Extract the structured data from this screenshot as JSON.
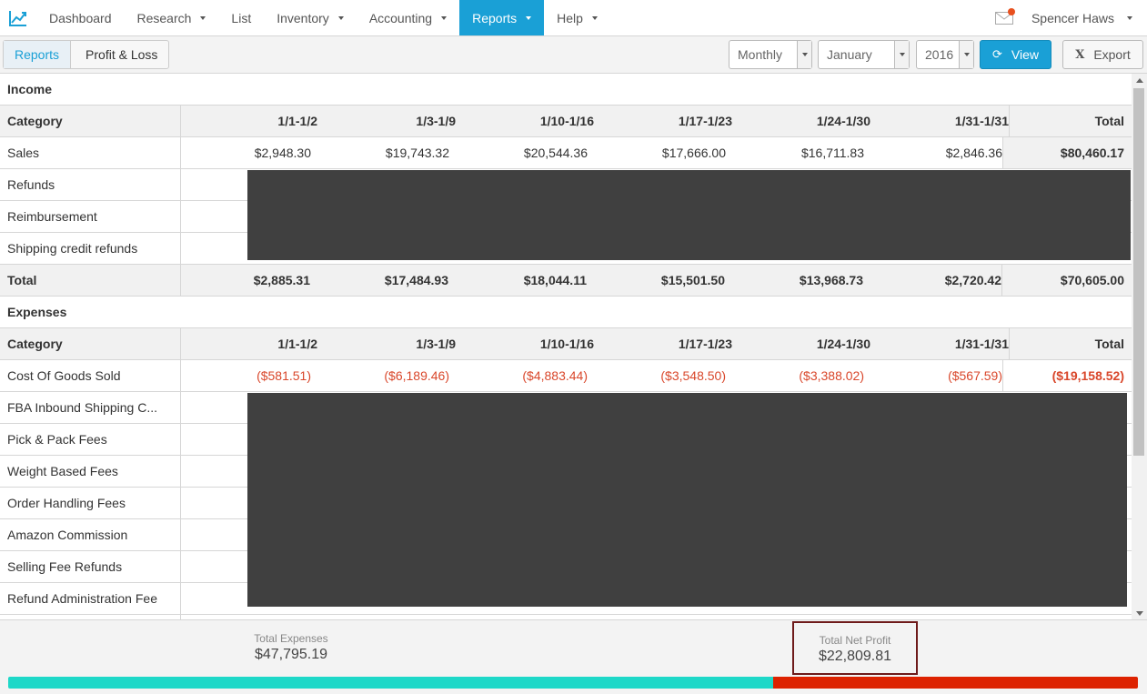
{
  "nav": {
    "items": [
      {
        "label": "Dashboard",
        "dropdown": false,
        "active": false
      },
      {
        "label": "Research",
        "dropdown": true,
        "active": false
      },
      {
        "label": "List",
        "dropdown": false,
        "active": false
      },
      {
        "label": "Inventory",
        "dropdown": true,
        "active": false
      },
      {
        "label": "Accounting",
        "dropdown": true,
        "active": false
      },
      {
        "label": "Reports",
        "dropdown": true,
        "active": true
      },
      {
        "label": "Help",
        "dropdown": true,
        "active": false
      }
    ],
    "user": "Spencer Haws",
    "accent": "#1aa0d6",
    "notification_color": "#e8501e"
  },
  "toolbar": {
    "breadcrumb": [
      "Reports",
      "Profit & Loss"
    ],
    "period": "Monthly",
    "month": "January",
    "year": "2016",
    "view_label": "View",
    "export_label": "Export"
  },
  "income": {
    "title": "Income",
    "header": [
      "Category",
      "1/1-1/2",
      "1/3-1/9",
      "1/10-1/16",
      "1/17-1/23",
      "1/24-1/30",
      "1/31-1/31",
      "Total"
    ],
    "rows": [
      [
        "Sales",
        "$2,948.30",
        "$19,743.32",
        "$20,544.36",
        "$17,666.00",
        "$16,711.83",
        "$2,846.36",
        "$80,460.17"
      ],
      [
        "Refunds"
      ],
      [
        "Reimbursement"
      ],
      [
        "Shipping credit refunds"
      ]
    ],
    "total": [
      "Total",
      "$2,885.31",
      "$17,484.93",
      "$18,044.11",
      "$15,501.50",
      "$13,968.73",
      "$2,720.42",
      "$70,605.00"
    ]
  },
  "expenses": {
    "title": "Expenses",
    "header": [
      "Category",
      "1/1-1/2",
      "1/3-1/9",
      "1/10-1/16",
      "1/17-1/23",
      "1/24-1/30",
      "1/31-1/31",
      "Total"
    ],
    "rows": [
      [
        "Cost Of Goods Sold",
        "($581.51)",
        "($6,189.46)",
        "($4,883.44)",
        "($3,548.50)",
        "($3,388.02)",
        "($567.59)",
        "($19,158.52)"
      ],
      [
        "FBA Inbound Shipping C..."
      ],
      [
        "Pick & Pack Fees"
      ],
      [
        "Weight Based Fees"
      ],
      [
        "Order Handling Fees"
      ],
      [
        "Amazon Commission"
      ],
      [
        "Selling Fee Refunds"
      ],
      [
        "Refund Administration Fee"
      ]
    ]
  },
  "footer": {
    "total_expenses_label": "Total Expenses",
    "total_expenses": "$47,795.19",
    "net_profit_label": "Total Net Profit",
    "net_profit": "$22,809.81",
    "bar": {
      "profit_fraction": 0.677,
      "profit_color": "#1ed8c8",
      "expense_color": "#dd2200"
    }
  }
}
